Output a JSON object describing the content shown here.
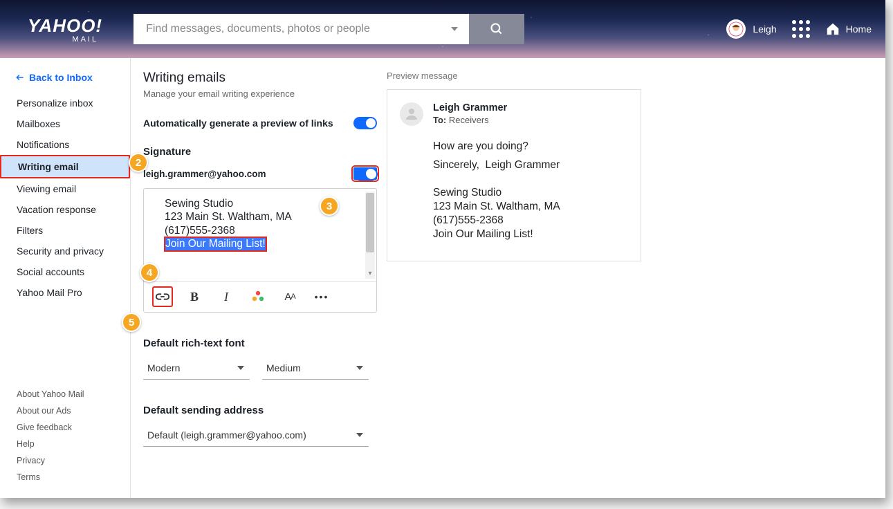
{
  "header": {
    "logo_main": "YAHOO",
    "logo_sub": "MAIL",
    "search_placeholder": "Find messages, documents, photos or people",
    "user_name": "Leigh",
    "home_label": "Home"
  },
  "sidebar": {
    "back": "Back to Inbox",
    "items": [
      "Personalize inbox",
      "Mailboxes",
      "Notifications",
      "Writing email",
      "Viewing email",
      "Vacation response",
      "Filters",
      "Security and privacy",
      "Social accounts",
      "Yahoo Mail Pro"
    ],
    "active_index": 3,
    "footer": [
      "About Yahoo Mail",
      "About our Ads",
      "Give feedback",
      "Help",
      "Privacy",
      "Terms"
    ]
  },
  "settings": {
    "title": "Writing emails",
    "subtitle": "Manage your email writing experience",
    "auto_preview_label": "Automatically generate a preview of links",
    "signature_label": "Signature",
    "account_email": "leigh.grammer@yahoo.com",
    "signature_lines": [
      "Sewing Studio",
      "123 Main St. Waltham, MA",
      "(617)555-2368"
    ],
    "signature_selected": "Join Our Mailing List!",
    "font_section": "Default rich-text font",
    "font_face": "Modern",
    "font_size": "Medium",
    "sending_section": "Default sending address",
    "sending_value": "Default (leigh.grammer@yahoo.com)"
  },
  "preview": {
    "label": "Preview message",
    "from": "Leigh Grammer",
    "to_label": "To:",
    "to_value": "Receivers",
    "body1": "How are you doing?",
    "body2a": "Sincerely,",
    "body2b": "Leigh Grammer",
    "sig": [
      "Sewing Studio",
      "123 Main St. Waltham, MA",
      "(617)555-2368",
      "Join Our Mailing List!"
    ]
  },
  "callouts": {
    "c2": "2",
    "c3": "3",
    "c4": "4",
    "c5": "5"
  }
}
